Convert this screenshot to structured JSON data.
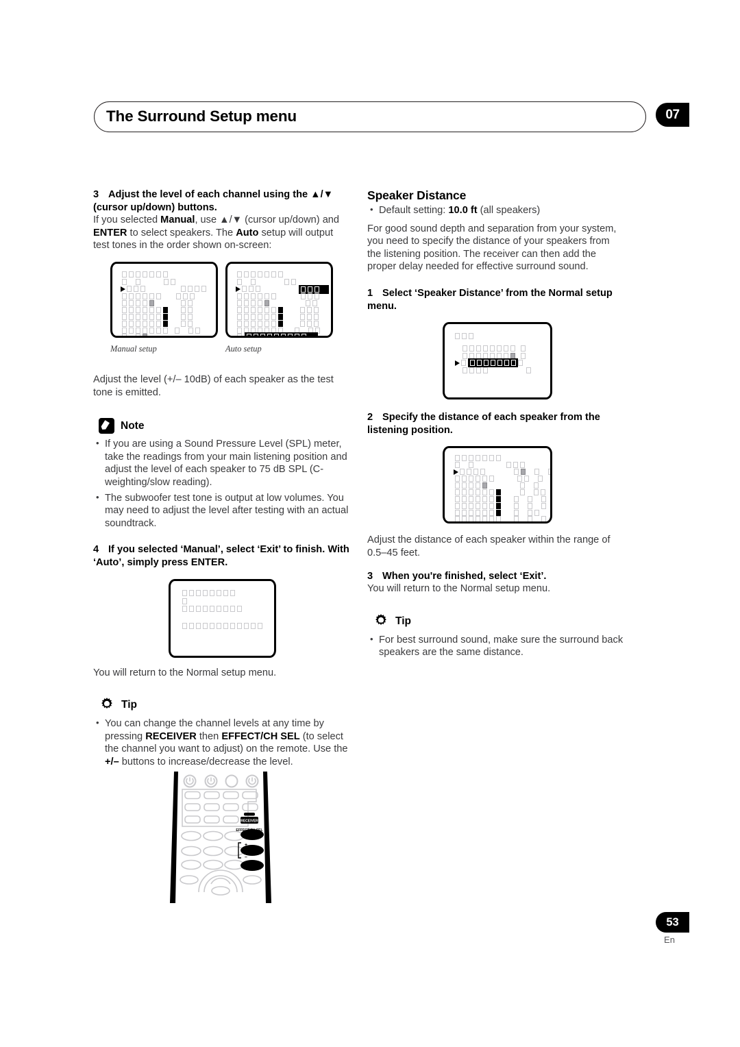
{
  "header": {
    "title": "The Surround Setup menu",
    "chapter": "07"
  },
  "footer": {
    "page_number": "53",
    "language": "En"
  },
  "left_column": {
    "step3": {
      "number": "3",
      "heading": "Adjust the level of each channel using the ▲/▼ (cursor up/down) buttons.",
      "body_1": "If you selected ",
      "bold_1": "Manual",
      "body_2": ", use ▲/▼ (cursor up/down) and ",
      "bold_2": "ENTER",
      "body_3": " to select speakers. The ",
      "bold_3": "Auto",
      "body_4": " setup will output test tones in the order shown on-screen:"
    },
    "screens": {
      "manual_caption": "Manual setup",
      "auto_caption": "Auto setup"
    },
    "after_screens": "Adjust the level (+/– 10dB) of each speaker as the test tone is emitted.",
    "note": {
      "label": "Note",
      "icon": "pencil-note-icon",
      "items": [
        "If you are using a Sound Pressure Level (SPL) meter, take the readings from your main listening position and adjust the level of each speaker to 75 dB SPL (C-weighting/slow reading).",
        "The subwoofer test tone is output at low volumes. You may need to adjust the level after testing with an actual soundtrack."
      ]
    },
    "step4": {
      "number": "4",
      "heading": "If you selected ‘Manual’, select ‘Exit’ to finish. With ‘Auto’, simply press ENTER."
    },
    "after_step4": "You will return to the Normal setup menu.",
    "tip": {
      "label": "Tip",
      "icon": "lightbulb-tip-icon",
      "text_1": "You can change the channel levels at any time by pressing ",
      "bold_1": "RECEIVER",
      "text_2": " then ",
      "bold_2": "EFFECT/CH SEL",
      "text_3": " (to select the channel you want to adjust) on the remote. Use the ",
      "bold_3": "+/–",
      "text_4": " buttons to increase/decrease the level."
    },
    "remote": {
      "receiver_label": "RECEIVER",
      "effect_label": "EFFECT/CH SEL",
      "plus_label": "+",
      "minus_label": "–"
    }
  },
  "right_column": {
    "section_title": "Speaker Distance",
    "default_setting": {
      "prefix": "Default setting: ",
      "value": "10.0 ft",
      "suffix": " (all speakers)"
    },
    "intro": "For good sound depth and separation from your system, you need to specify the distance of your speakers from the listening position. The receiver can then add the proper delay needed for effective surround sound.",
    "step1": {
      "number": "1",
      "heading": "Select ‘Speaker Distance’ from the Normal setup menu."
    },
    "step2": {
      "number": "2",
      "heading": "Specify the distance of each speaker from the listening position."
    },
    "after_step2": "Adjust the distance of each speaker within the range of 0.5–45 feet.",
    "step3": {
      "number": "3",
      "heading": "When you're finished, select ‘Exit’.",
      "body": "You will return to the Normal setup menu."
    },
    "tip": {
      "label": "Tip",
      "icon": "lightbulb-tip-icon",
      "text": "For best surround sound, make sure the surround back speakers are the same distance."
    }
  }
}
